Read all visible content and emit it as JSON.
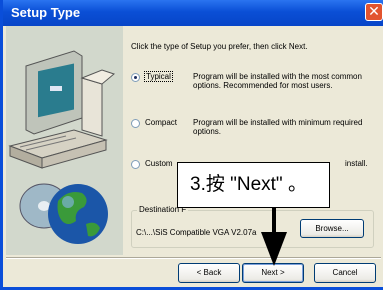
{
  "window": {
    "title": "Setup Type",
    "close_glyph": "✕"
  },
  "instructions": "Click the type of Setup you prefer, then click Next.",
  "options": [
    {
      "label": "Typical",
      "selected": true,
      "description": "Program will be installed with the most common options. Recommended for most users."
    },
    {
      "label": "Compact",
      "selected": false,
      "description": "Program will be installed with minimum required options."
    },
    {
      "label": "Custom",
      "selected": false,
      "description": "install."
    }
  ],
  "destination": {
    "group_label": "Destination F",
    "path": "C:\\...\\SiS Compatible VGA V2.07a",
    "browse_label": "Browse..."
  },
  "buttons": {
    "back": "< Back",
    "next": "Next >",
    "cancel": "Cancel"
  },
  "annotation": {
    "text": "3.按 \"Next\" 。"
  },
  "icons": [
    "computer-illustration",
    "globe-disc-illustration",
    "close-icon",
    "arrow-pointer"
  ],
  "colors": {
    "titlebar": "#0a4fd6",
    "dialog": "#ece9d8",
    "close": "#e2542f"
  }
}
